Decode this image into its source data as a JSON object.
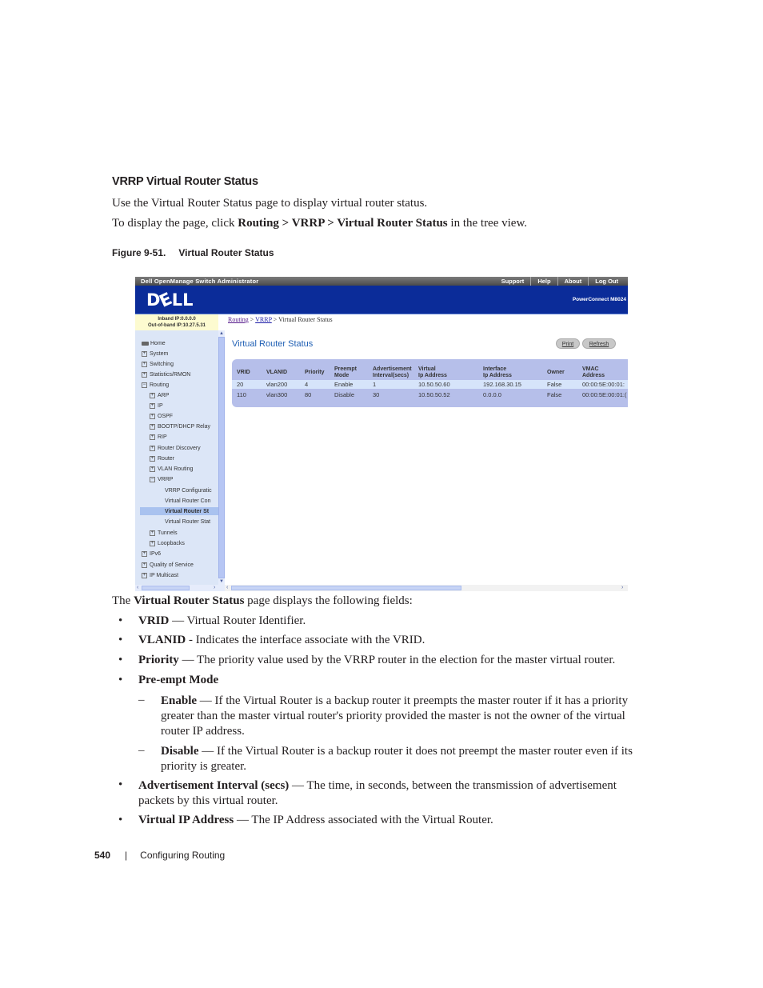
{
  "section": {
    "title": "VRRP Virtual Router Status",
    "intro": "Use the Virtual Router Status page to display virtual router status.",
    "nav_prefix": "To display the page, click ",
    "nav_path": "Routing > VRRP > Virtual Router Status",
    "nav_suffix": " in the tree view.",
    "figure_label": "Figure 9-51.",
    "figure_title": "Virtual Router Status"
  },
  "screenshot": {
    "app_title": "Dell OpenManage Switch Administrator",
    "top_links": [
      "Support",
      "Help",
      "About",
      "Log Out"
    ],
    "logo": "DELL",
    "model": "PowerConnect M8024",
    "inband_ip": "Inband IP:0.0.0.0",
    "oob_ip": "Out-of-band IP:10.27.5.31",
    "breadcrumb": {
      "routing": "Routing",
      "vrrp": "VRRP",
      "current": "Virtual Router Status",
      "sep": " > "
    },
    "page_title": "Virtual Router Status",
    "buttons": {
      "print": "Print",
      "refresh": "Refresh"
    },
    "tree": [
      {
        "label": "Home",
        "level": 0,
        "icon": "home"
      },
      {
        "label": "System",
        "level": 0,
        "icon": "plus"
      },
      {
        "label": "Switching",
        "level": 0,
        "icon": "plus"
      },
      {
        "label": "Statistics/RMON",
        "level": 0,
        "icon": "plus"
      },
      {
        "label": "Routing",
        "level": 0,
        "icon": "minus"
      },
      {
        "label": "ARP",
        "level": 1,
        "icon": "plus"
      },
      {
        "label": "IP",
        "level": 1,
        "icon": "plus"
      },
      {
        "label": "OSPF",
        "level": 1,
        "icon": "plus"
      },
      {
        "label": "BOOTP/DHCP Relay",
        "level": 1,
        "icon": "plus"
      },
      {
        "label": "RIP",
        "level": 1,
        "icon": "plus"
      },
      {
        "label": "Router Discovery",
        "level": 1,
        "icon": "plus"
      },
      {
        "label": "Router",
        "level": 1,
        "icon": "plus"
      },
      {
        "label": "VLAN Routing",
        "level": 1,
        "icon": "plus"
      },
      {
        "label": "VRRP",
        "level": 1,
        "icon": "minus"
      },
      {
        "label": "VRRP Configuratic",
        "level": 2,
        "icon": "none"
      },
      {
        "label": "Virtual Router Con",
        "level": 2,
        "icon": "none"
      },
      {
        "label": "Virtual Router St",
        "level": 2,
        "icon": "none",
        "selected": true
      },
      {
        "label": "Virtual Router Stat",
        "level": 2,
        "icon": "none"
      },
      {
        "label": "Tunnels",
        "level": 1,
        "icon": "plus"
      },
      {
        "label": "Loopbacks",
        "level": 1,
        "icon": "plus"
      },
      {
        "label": "IPv6",
        "level": 0,
        "icon": "plus"
      },
      {
        "label": "Quality of Service",
        "level": 0,
        "icon": "plus"
      },
      {
        "label": "IP Multicast",
        "level": 0,
        "icon": "plus"
      }
    ],
    "table": {
      "headers": [
        [
          "VRID",
          ""
        ],
        [
          "VLANID",
          ""
        ],
        [
          "Priority",
          ""
        ],
        [
          "Preempt",
          "Mode"
        ],
        [
          "Advertisement",
          "Interval(secs)"
        ],
        [
          "Virtual",
          "Ip Address"
        ],
        [
          "Interface",
          "Ip Address"
        ],
        [
          "Owner",
          ""
        ],
        [
          "VMAC",
          "Address"
        ]
      ],
      "rows": [
        [
          "20",
          "vlan200",
          "4",
          "Enable",
          "1",
          "10.50.50.60",
          "192.168.30.15",
          "False",
          "00:00:5E:00:01:"
        ],
        [
          "110",
          "vlan300",
          "80",
          "Disable",
          "30",
          "10.50.50.52",
          "0.0.0.0",
          "False",
          "00:00:5E:00:01:("
        ]
      ]
    }
  },
  "body": {
    "fields_intro_pre": "The ",
    "fields_intro_bold": "Virtual Router Status",
    "fields_intro_post": " page displays the following fields:",
    "bullets": [
      {
        "term": "VRID",
        "sep": " — ",
        "desc": "Virtual Router Identifier."
      },
      {
        "term": "VLANID",
        "sep": " - ",
        "desc": "Indicates the interface associate with the VRID."
      },
      {
        "term": "Priority",
        "sep": " — ",
        "desc": "The priority value used by the VRRP router in the election for the master virtual router."
      },
      {
        "term": "Pre-empt Mode",
        "sep": "",
        "desc": ""
      }
    ],
    "sub_bullets": [
      {
        "term": "Enable",
        "sep": " — ",
        "desc": "If the Virtual Router is a backup router it preempts the master router if it has a priority greater than the master virtual router's priority provided the master is not the owner of the virtual router IP address."
      },
      {
        "term": "Disable",
        "sep": " — ",
        "desc": "If the Virtual Router is a backup router it does not preempt the master router even if its priority is greater."
      }
    ],
    "bullets2": [
      {
        "term": "Advertisement Interval (secs)",
        "sep": " — ",
        "desc": "The time, in seconds, between the transmission of advertisement packets by this virtual router."
      },
      {
        "term": "Virtual IP Address",
        "sep": " — ",
        "desc": "The IP Address associated with the Virtual Router."
      }
    ],
    "bullet_char": "•",
    "dash_char": "–"
  },
  "footer": {
    "page_number": "540",
    "separator": "|",
    "chapter": "Configuring Routing"
  },
  "colors": {
    "banner": "#0b2c99",
    "tree_bg": "#dce6f7",
    "panel": "#b6bfea",
    "title_blue": "#1f5fb4",
    "ip_box": "#fdfbd0"
  }
}
